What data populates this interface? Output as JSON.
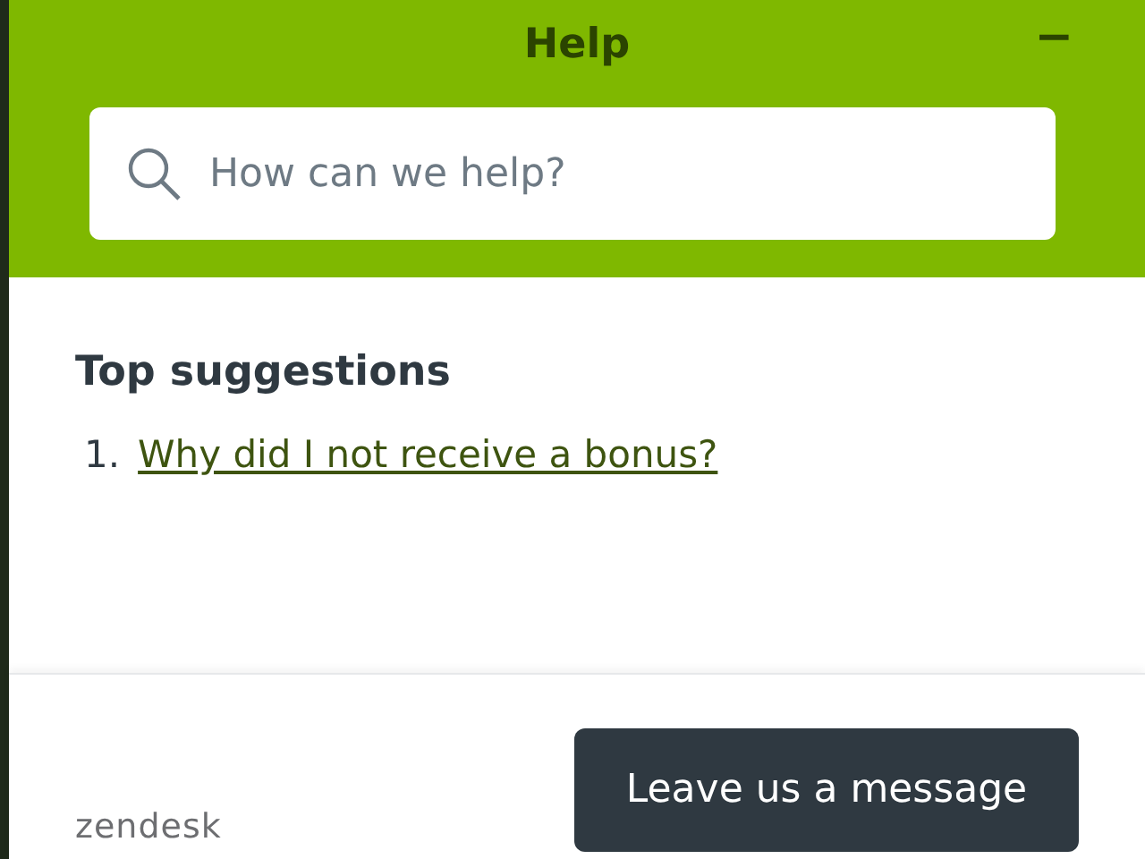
{
  "header": {
    "title": "Help",
    "minimize": "−"
  },
  "search": {
    "placeholder": "How can we help?"
  },
  "suggestions": {
    "heading": "Top suggestions",
    "items": [
      {
        "number": "1.",
        "text": "Why did I not receive a bonus?"
      }
    ]
  },
  "footer": {
    "logo": "zendesk",
    "button": "Leave us a message"
  }
}
